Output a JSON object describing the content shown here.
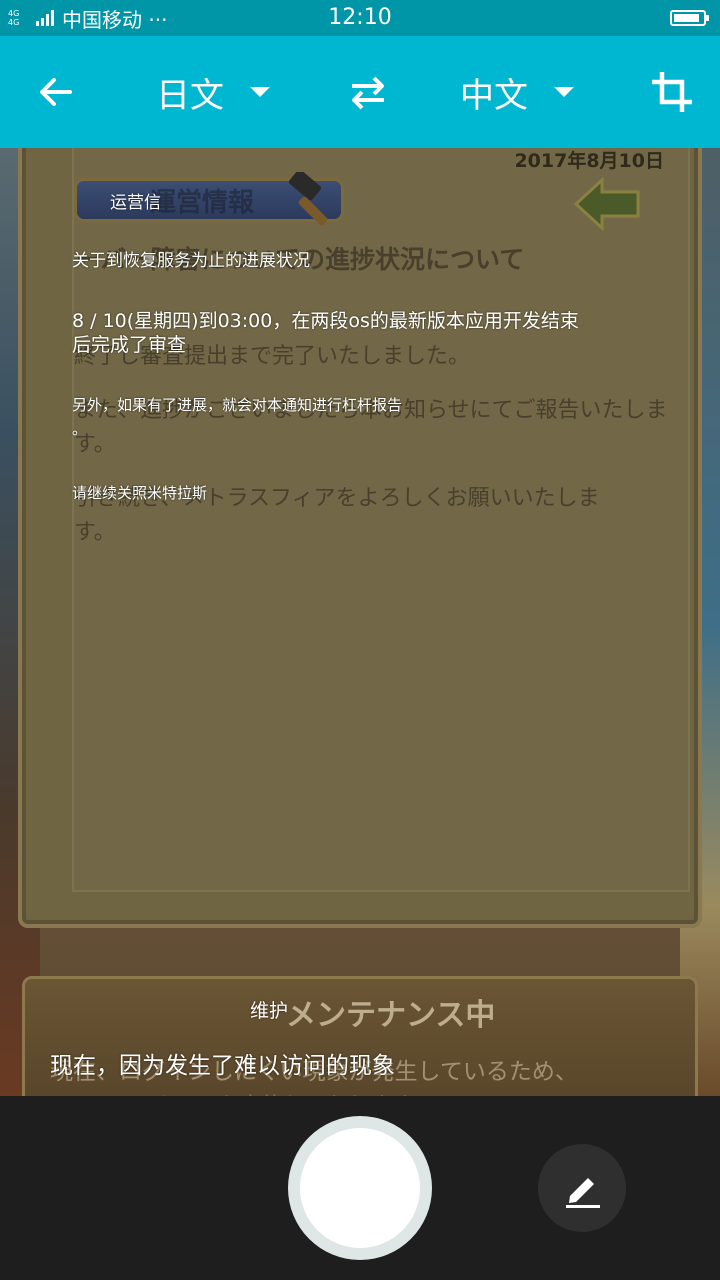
{
  "status_bar": {
    "network_label": "4G 4G",
    "carrier": "中国移动 ···",
    "time": "12:10",
    "battery_level": 0.9
  },
  "toolbar": {
    "source_language": "日文",
    "target_language": "中文",
    "icons": [
      "back-arrow-icon",
      "dropdown-caret-icon",
      "swap-icon",
      "crop-icon"
    ],
    "background_color": "#00b7d2"
  },
  "camera_image": {
    "date": "2017年8月10日",
    "badge_label": "運営情報",
    "jp_title": "ーバー障害についての進捗状況について",
    "jp_line1": "終了し審査提出まで完了いたしました。",
    "jp_line2a": "また、進捗がございましたら本お知らせにてご報告いたしま",
    "jp_line2b": "す。",
    "jp_line3a": "引き続き、メトラスフィアをよろしくお願いいたしま",
    "jp_line3b": "す。",
    "bottom_title": "メンテナンス中",
    "bottom_line1": "現在、ログインしにくい現象が発生しているため、",
    "bottom_line2": "メンテナンスを実施しております"
  },
  "translations": {
    "badge": "运营信",
    "title": "关于到恢复服务为止的进展状况",
    "para1_line1": "8 / 10(星期四)到03:00，在两段os的最新版本应用开发结束",
    "para1_line2": "后完成了审查",
    "para2_line1": "另外，如果有了进展，就会对本通知进行杠杆报告",
    "para2_line2": "。",
    "para3": "请继续关照米特拉斯",
    "bottom_title": "维护",
    "bottom_line": "现在，因为发生了难以访问的现象"
  },
  "controls": {
    "icons": [
      "shutter-button",
      "edit-icon"
    ]
  }
}
